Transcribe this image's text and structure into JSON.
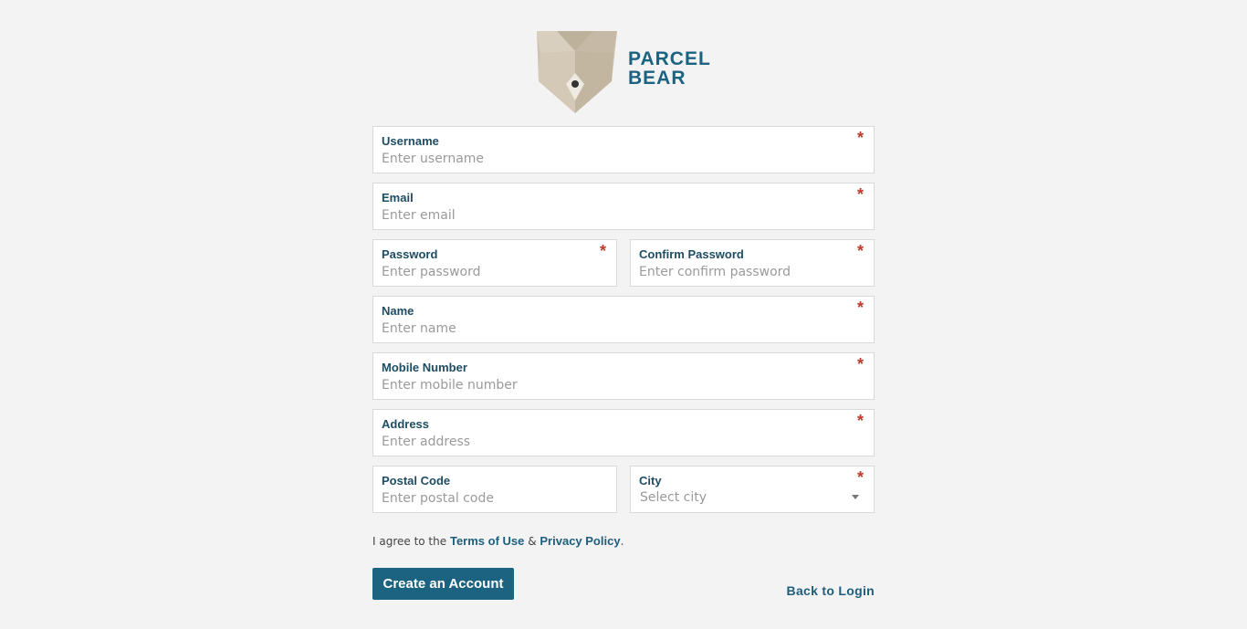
{
  "brand": {
    "line1": "PARCEL",
    "line2": "BEAR",
    "color": "#1b6380"
  },
  "fields": {
    "username": {
      "label": "Username",
      "placeholder": "Enter username",
      "required": "*"
    },
    "email": {
      "label": "Email",
      "placeholder": "Enter email",
      "required": "*"
    },
    "password": {
      "label": "Password",
      "placeholder": "Enter password",
      "required": "*"
    },
    "confirm_password": {
      "label": "Confirm Password",
      "placeholder": "Enter confirm password",
      "required": "*"
    },
    "name": {
      "label": "Name",
      "placeholder": "Enter name",
      "required": "*"
    },
    "mobile": {
      "label": "Mobile Number",
      "placeholder": "Enter mobile number",
      "required": "*"
    },
    "address": {
      "label": "Address",
      "placeholder": "Enter address",
      "required": "*"
    },
    "postal_code": {
      "label": "Postal Code",
      "placeholder": "Enter postal code"
    },
    "city": {
      "label": "City",
      "selected": "Select city",
      "required": "*"
    }
  },
  "agreement": {
    "prefix": "I agree to the",
    "terms": "Terms of Use",
    "amp": "&",
    "privacy": "Privacy Policy",
    "suffix": "."
  },
  "actions": {
    "create_account": "Create an Account",
    "back_to_login": "Back to Login"
  },
  "colors": {
    "accent": "#1b6380",
    "required": "#c0392b",
    "background": "#f3f3f3"
  }
}
